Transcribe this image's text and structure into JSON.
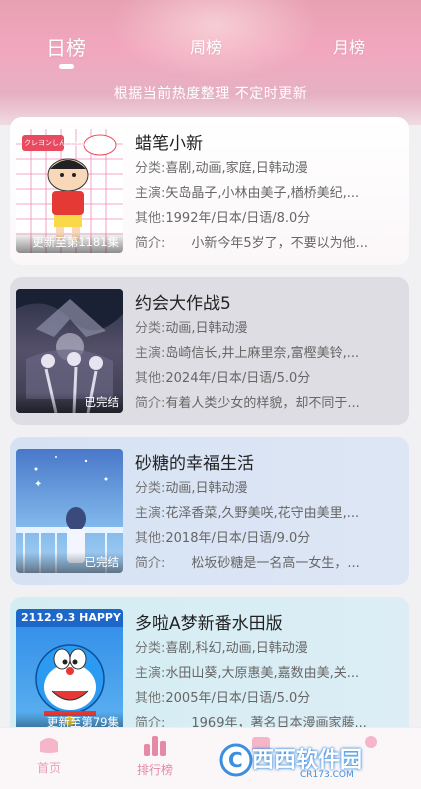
{
  "tabs": [
    {
      "label": "日榜"
    },
    {
      "label": "周榜"
    },
    {
      "label": "月榜"
    }
  ],
  "hint": "根据当前热度整理 不定时更新",
  "field_labels": {
    "genre": "分类:",
    "cast": "主演:",
    "other": "其他:",
    "intro": "简介:"
  },
  "items": [
    {
      "title": "蜡笔小新",
      "status": "更新至第1181集",
      "genre": "喜剧,动画,家庭,日韩动漫",
      "cast": "矢岛晶子,小林由美子,楢桥美纪,...",
      "other": "1992年/日本/日语/8.0分",
      "intro": "　　小新今年5岁了，不要以为他...",
      "poster_label": "クレヨンしんちゃん"
    },
    {
      "title": "约会大作战5",
      "status": "已完结",
      "genre": "动画,日韩动漫",
      "cast": "岛崎信长,井上麻里奈,富樫美铃,...",
      "other": "2024年/日本/日语/5.0分",
      "intro": "有着人类少女的样貌，却不同于..."
    },
    {
      "title": "砂糖的幸福生活",
      "status": "已完结",
      "genre": "动画,日韩动漫",
      "cast": "花泽香菜,久野美咲,花守由美里,...",
      "other": "2018年/日本/日语/9.0分",
      "intro": "　　松坂砂糖是一名高一女生，..."
    },
    {
      "title": "多啦A梦新番水田版",
      "status": "更新至第79集",
      "genre": "喜剧,科幻,动画,日韩动漫",
      "cast": "水田山葵,大原惠美,嘉数由美,关...",
      "other": "2005年/日本/日语/5.0分",
      "intro": "　　1969年，著名日本漫画家藤...",
      "poster_label": "2112.9.3 HAPPY"
    }
  ],
  "bottom_nav": [
    {
      "label": "首页"
    },
    {
      "label": "排行榜"
    }
  ],
  "watermark": {
    "text": "西西软件园",
    "sub": "CR173.COM"
  },
  "colors": {
    "accent": "#e48aa6",
    "hero": "#f2a7bf"
  }
}
